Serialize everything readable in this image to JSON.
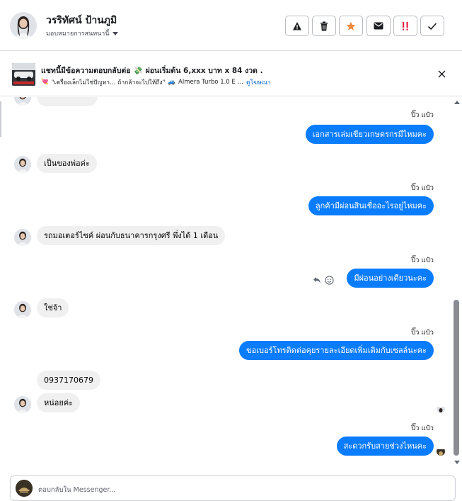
{
  "header": {
    "contact_name": "วรริทัศน์ ป้านภูมิ",
    "assign_label": "มอบหมายการสนทนานี้"
  },
  "toolbar": {
    "buttons": [
      {
        "name": "warning-icon",
        "color": "#1c1e21"
      },
      {
        "name": "trash-icon",
        "color": "#1c1e21"
      },
      {
        "name": "star-icon",
        "color": "#f0883e"
      },
      {
        "name": "mail-icon",
        "color": "#1c1e21"
      },
      {
        "name": "follow-up-icon",
        "color": "#e41e3f"
      },
      {
        "name": "check-icon",
        "color": "#1c1e21"
      }
    ]
  },
  "ad": {
    "title": "แชทนี้มีข้อความตอบกลับต่อ",
    "title_emoji": "💸",
    "title_rest": "ผ่อนเริ่มต้น 6,xxx บาท x 84 งวด .",
    "sub_emoji": "💘",
    "sub_text": "\"เครื่องเล็กไม่ใช่ปัญหา… ถ้ากล้าจะไปให้ถึง\"",
    "sub_emoji2": "🚙",
    "sub_text2": "Almera Turbo 1.0 E …",
    "view_ad_label": "ดูโฆษณา"
  },
  "messages": [
    {
      "dir": "out",
      "timestamp": "ปิ๊ว แป๋ว",
      "text": "เอกสารเล่มเขียวเกษตรกรมีไหมคะ"
    },
    {
      "dir": "in",
      "text": "เป็นของพ่อค่ะ"
    },
    {
      "dir": "out",
      "timestamp": "ปิ๊ว แป๋ว",
      "text": "ลูกค้ามีผ่อนสินเชื่ออะไรอยู่ไหมคะ"
    },
    {
      "dir": "in",
      "text": "รถมอเตอร์ไซค์ ผ่อนกับธนาคารกรุงศรี พึ่งได้ 1 เดือน"
    },
    {
      "dir": "out",
      "timestamp": "ปิ๊ว แป๋ว",
      "text": "มีผ่อนอย่างเดียวนะคะ"
    },
    {
      "dir": "in",
      "text": "ใช่จ้า"
    },
    {
      "dir": "out",
      "timestamp": "ปิ๊ว แป๋ว",
      "text": "ขอเบอร์โทรติดต่อคุยรายละเอียดเพิ่มเติมกับเซลล์นะคะ"
    },
    {
      "dir": "in",
      "text": "0937170679"
    },
    {
      "dir": "in",
      "text": "หน่อยค่ะ"
    },
    {
      "dir": "out",
      "timestamp": "ปิ๊ว แป๋ว",
      "text": "สะดวกรับสายช่วงไหนคะ"
    }
  ],
  "composer": {
    "placeholder": "ตอบกลับใน Messenger..."
  },
  "colors": {
    "outgoing_bubble": "#0a7cff",
    "incoming_bubble": "#f0f0f0",
    "link": "#0064d1"
  }
}
